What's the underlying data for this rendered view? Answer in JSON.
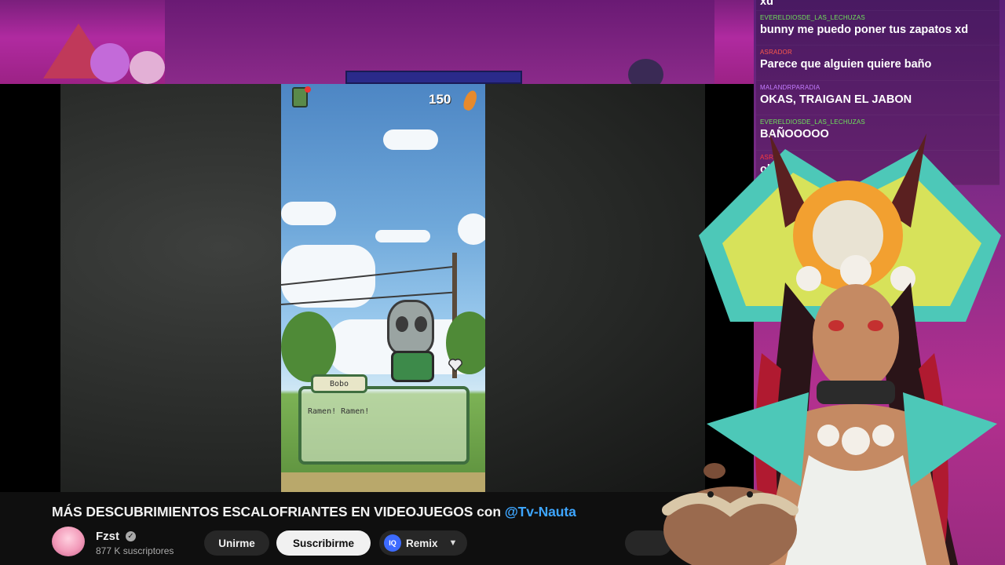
{
  "stream": {
    "chat_messages": [
      {
        "user": "",
        "user_color": "#ffffff",
        "text": "xd"
      },
      {
        "user": "EVERELDIOSDE_LAS_LECHUZAS",
        "user_color": "#6fe35a",
        "text": "bunny me puedo poner tus zapatos xd"
      },
      {
        "user": "ASRADOR",
        "user_color": "#ff5a4a",
        "text": "Parece que alguien quiere baño"
      },
      {
        "user": "MALANDRPARADIA",
        "user_color": "#c47cff",
        "text": "OKAS, TRAIGAN EL JABON"
      },
      {
        "user": "EVERELDIOSDE_LAS_LECHUZAS",
        "user_color": "#6fe35a",
        "text": "BAÑOOOOO"
      },
      {
        "user": "ASRADOR",
        "user_color": "#ff3a3a",
        "text": "oh no"
      }
    ]
  },
  "game": {
    "score": "150",
    "npc_name": "Bobo",
    "dialog": "Ramen! Ramen!"
  },
  "video": {
    "title_main": "MÁS DESCUBRIMIENTOS ESCALOFRIANTES EN VIDEOJUEGOS con ",
    "title_mention": "@Tv-Nauta",
    "channel_name": "Fzst",
    "subscribers": "877 K suscriptores",
    "join_label": "Unirme",
    "subscribe_label": "Suscribirme",
    "remix_label": "Remix",
    "remix_icon_text": "IQ"
  },
  "colors": {
    "mention": "#3ea6ff",
    "subscribe_bg": "#f1f1f1",
    "bar_bg": "#0f0f0f"
  }
}
